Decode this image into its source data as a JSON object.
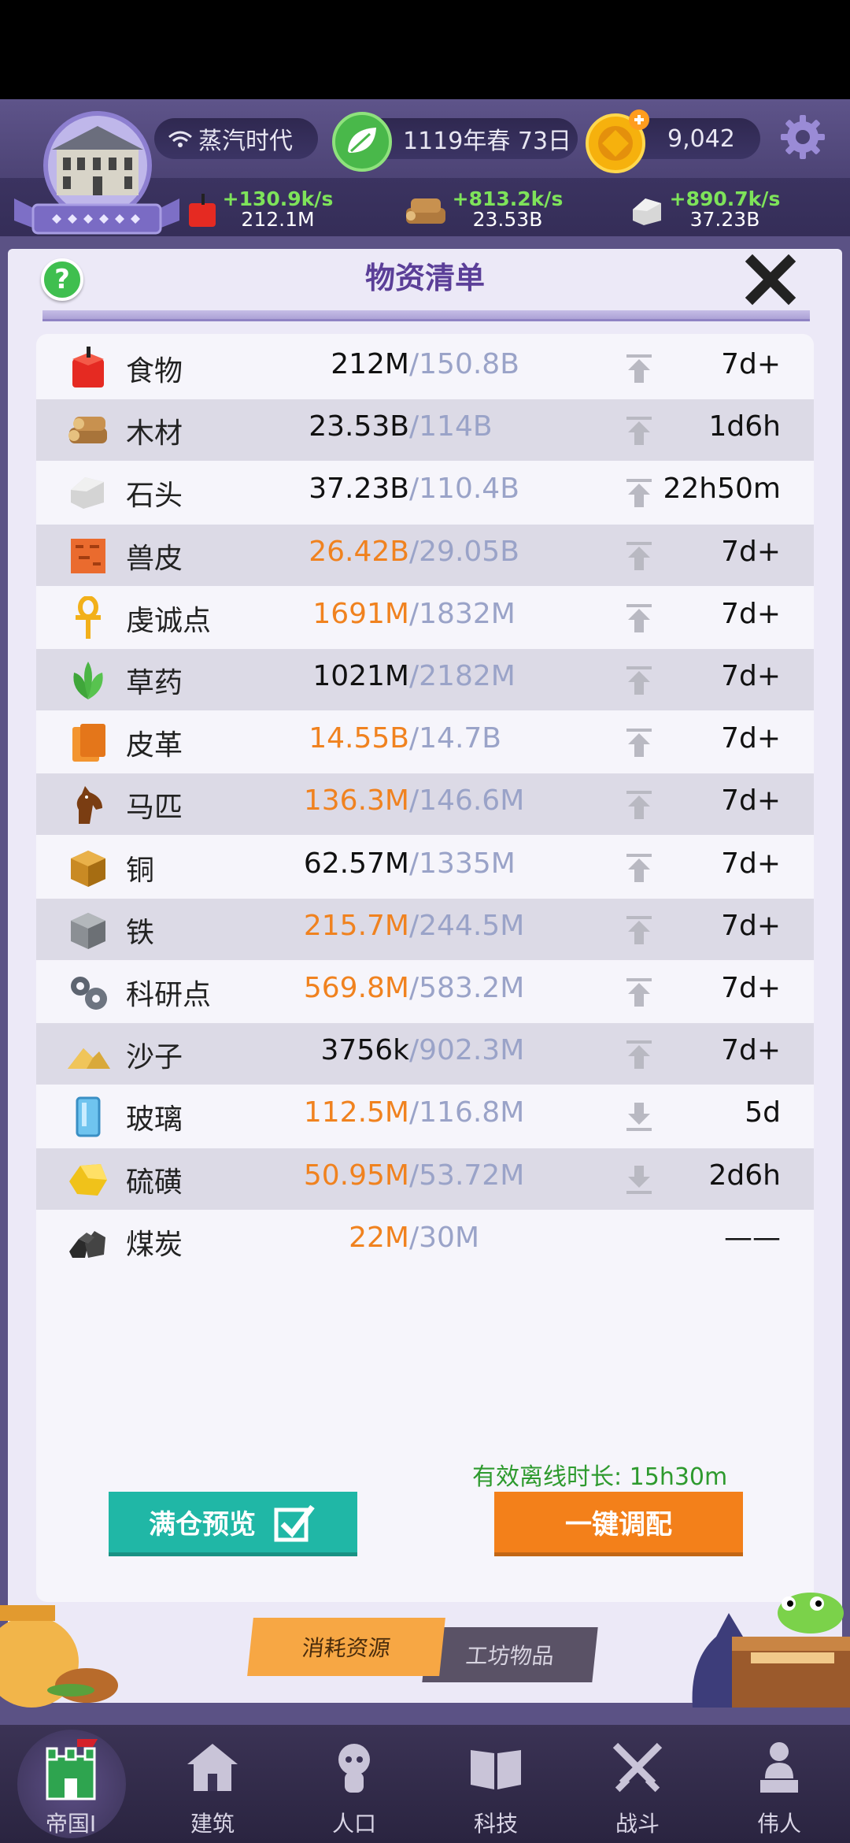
{
  "header": {
    "era": "蒸汽时代",
    "date": "1119年春 73日",
    "coins": "9,042",
    "resources": [
      {
        "rate": "+130.9k/s",
        "total": "212.1M",
        "icon": "apple-icon"
      },
      {
        "rate": "+813.2k/s",
        "total": "23.53B",
        "icon": "wood-icon"
      },
      {
        "rate": "+890.7k/s",
        "total": "37.23B",
        "icon": "stone-icon"
      }
    ]
  },
  "panel": {
    "title": "物资清单",
    "help": "?"
  },
  "items": [
    {
      "name": "食物",
      "value": "212M",
      "cap": "/150.8B",
      "trend": "up",
      "time": "7d+",
      "value_color": "#111111",
      "icon": "apple-icon"
    },
    {
      "name": "木材",
      "value": "23.53B",
      "cap": "/114B",
      "trend": "up",
      "time": "1d6h",
      "value_color": "#111111",
      "icon": "wood-icon"
    },
    {
      "name": "石头",
      "value": "37.23B",
      "cap": "/110.4B",
      "trend": "up",
      "time": "22h50m",
      "value_color": "#111111",
      "icon": "stone-icon"
    },
    {
      "name": "兽皮",
      "value": "26.42B",
      "cap": "/29.05B",
      "trend": "up",
      "time": "7d+",
      "value_color": "#f0821f",
      "icon": "hide-icon"
    },
    {
      "name": "虔诚点",
      "value": "1691M",
      "cap": "/1832M",
      "trend": "up",
      "time": "7d+",
      "value_color": "#f0821f",
      "icon": "ankh-icon"
    },
    {
      "name": "草药",
      "value": "1021M",
      "cap": "/2182M",
      "trend": "up",
      "time": "7d+",
      "value_color": "#111111",
      "icon": "herb-icon"
    },
    {
      "name": "皮革",
      "value": "14.55B",
      "cap": "/14.7B",
      "trend": "up",
      "time": "7d+",
      "value_color": "#f0821f",
      "icon": "leather-icon"
    },
    {
      "name": "马匹",
      "value": "136.3M",
      "cap": "/146.6M",
      "trend": "up",
      "time": "7d+",
      "value_color": "#f0821f",
      "icon": "horse-icon"
    },
    {
      "name": "铜",
      "value": "62.57M",
      "cap": "/1335M",
      "trend": "up",
      "time": "7d+",
      "value_color": "#111111",
      "icon": "copper-icon"
    },
    {
      "name": "铁",
      "value": "215.7M",
      "cap": "/244.5M",
      "trend": "up",
      "time": "7d+",
      "value_color": "#f0821f",
      "icon": "iron-icon"
    },
    {
      "name": "科研点",
      "value": "569.8M",
      "cap": "/583.2M",
      "trend": "up",
      "time": "7d+",
      "value_color": "#f0821f",
      "icon": "gears-icon"
    },
    {
      "name": "沙子",
      "value": "3756k",
      "cap": "/902.3M",
      "trend": "up",
      "time": "7d+",
      "value_color": "#111111",
      "icon": "sand-icon"
    },
    {
      "name": "玻璃",
      "value": "112.5M",
      "cap": "/116.8M",
      "trend": "down",
      "time": "5d",
      "value_color": "#f0821f",
      "icon": "glass-icon"
    },
    {
      "name": "硫磺",
      "value": "50.95M",
      "cap": "/53.72M",
      "trend": "down",
      "time": "2d6h",
      "value_color": "#f0821f",
      "icon": "sulfur-icon"
    },
    {
      "name": "煤炭",
      "value": "22M",
      "cap": "/30M",
      "trend": "none",
      "time": "——",
      "value_color": "#f0821f",
      "icon": "coal-icon"
    }
  ],
  "offline_label": "有效离线时长: 15h30m",
  "buttons": {
    "preview": "满仓预览",
    "allocate": "一键调配"
  },
  "tabs": {
    "consumables": "消耗资源",
    "workshop": "工坊物品"
  },
  "nav": [
    {
      "label": "帝国I",
      "icon": "castle-icon"
    },
    {
      "label": "建筑",
      "icon": "house-icon"
    },
    {
      "label": "人口",
      "icon": "person-icon"
    },
    {
      "label": "科技",
      "icon": "book-icon"
    },
    {
      "label": "战斗",
      "icon": "swords-icon"
    },
    {
      "label": "伟人",
      "icon": "statue-icon"
    }
  ]
}
